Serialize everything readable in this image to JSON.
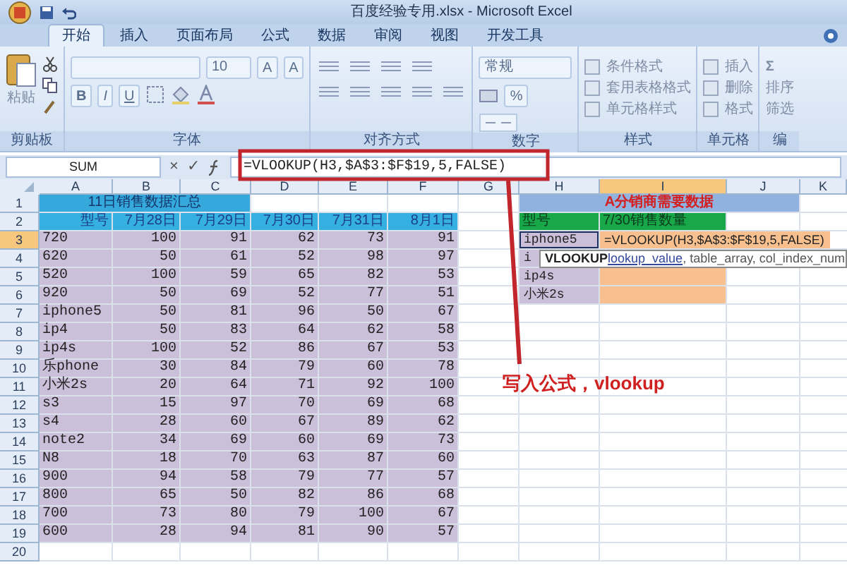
{
  "window": {
    "title": "百度经验专用.xlsx - Microsoft Excel"
  },
  "tabs": [
    {
      "label": "开始",
      "selected": true
    },
    {
      "label": "插入",
      "selected": false
    },
    {
      "label": "页面布局",
      "selected": false
    },
    {
      "label": "公式",
      "selected": false
    },
    {
      "label": "数据",
      "selected": false
    },
    {
      "label": "审阅",
      "selected": false
    },
    {
      "label": "视图",
      "selected": false
    },
    {
      "label": "开发工具",
      "selected": false
    }
  ],
  "ribbon": {
    "groups": [
      {
        "kind": "clipboard",
        "label": "剪贴板",
        "paste": "粘贴"
      },
      {
        "kind": "font",
        "label": "字体",
        "size": "10",
        "grow_shrink": [
          "A",
          "A"
        ],
        "style_buttons": [
          "B",
          "I",
          "U"
        ]
      },
      {
        "kind": "align",
        "label": "对齐方式"
      },
      {
        "kind": "number",
        "label": "数字",
        "format": "常规",
        "percent": "%"
      },
      {
        "kind": "list",
        "label": "样式",
        "items": [
          "条件格式",
          "套用表格格式",
          "单元格样式"
        ]
      },
      {
        "kind": "list",
        "label": "单元格",
        "items": [
          "插入",
          "删除",
          "格式"
        ]
      },
      {
        "kind": "editing",
        "label": "编",
        "sigma": "Σ",
        "items": [
          "排序",
          "筛选"
        ]
      }
    ]
  },
  "formula_bar": {
    "name_box": "SUM",
    "cancel": "×",
    "enter": "✓",
    "formula": "=VLOOKUP(H3,$A$3:$F$19,5,FALSE)"
  },
  "sheet": {
    "columns": [
      {
        "label": "A",
        "selected": false
      },
      {
        "label": "B",
        "selected": false
      },
      {
        "label": "C",
        "selected": false
      },
      {
        "label": "D",
        "selected": false
      },
      {
        "label": "E",
        "selected": false
      },
      {
        "label": "F",
        "selected": false
      },
      {
        "label": "G",
        "selected": false
      },
      {
        "label": "H",
        "selected": false
      },
      {
        "label": "I",
        "selected": true
      },
      {
        "label": "J",
        "selected": false
      },
      {
        "label": "K",
        "selected": false
      }
    ],
    "rows": [
      {
        "number": "1",
        "selected": false,
        "cells": [
          {
            "kind": "title",
            "text": "11日销售数据汇总"
          },
          {
            "kind": "empty"
          },
          {
            "kind": "empty"
          },
          {
            "kind": "empty"
          },
          {
            "kind": "empty"
          },
          {
            "kind": "banner",
            "text": "A分销商需要数据"
          }
        ]
      },
      {
        "number": "2",
        "selected": false,
        "cells": [
          {
            "kind": "header",
            "text": "型号"
          },
          {
            "kind": "header",
            "text": "7月28日"
          },
          {
            "kind": "header",
            "text": "7月29日"
          },
          {
            "kind": "header",
            "text": "7月30日"
          },
          {
            "kind": "header",
            "text": "7月31日"
          },
          {
            "kind": "header",
            "text": "8月1日"
          },
          {
            "kind": "empty"
          },
          {
            "kind": "key-header",
            "text": "型号"
          },
          {
            "kind": "key-header",
            "text": "7/30销售数量"
          }
        ]
      },
      {
        "number": "3",
        "selected": true,
        "cells": [
          {
            "kind": "text",
            "text": "720"
          },
          {
            "kind": "number",
            "text": "100"
          },
          {
            "kind": "number",
            "text": "91"
          },
          {
            "kind": "number",
            "text": "62"
          },
          {
            "kind": "number",
            "text": "73"
          },
          {
            "kind": "number",
            "text": "91"
          },
          {
            "kind": "empty"
          },
          {
            "kind": "key",
            "text": "iphone5"
          },
          {
            "kind": "editing",
            "text": "=VLOOKUP(H3,$A$3:$F$19,5,FALSE)"
          }
        ]
      },
      {
        "number": "4",
        "selected": false,
        "cells": [
          {
            "kind": "text",
            "text": "620"
          },
          {
            "kind": "number",
            "text": "50"
          },
          {
            "kind": "number",
            "text": "61"
          },
          {
            "kind": "number",
            "text": "52"
          },
          {
            "kind": "number",
            "text": "98"
          },
          {
            "kind": "number",
            "text": "97"
          },
          {
            "kind": "empty"
          },
          {
            "kind": "key",
            "text": "i"
          },
          {
            "kind": "lookup"
          }
        ]
      },
      {
        "number": "5",
        "selected": false,
        "cells": [
          {
            "kind": "text",
            "text": "520"
          },
          {
            "kind": "number",
            "text": "100"
          },
          {
            "kind": "number",
            "text": "59"
          },
          {
            "kind": "number",
            "text": "65"
          },
          {
            "kind": "number",
            "text": "82"
          },
          {
            "kind": "number",
            "text": "53"
          },
          {
            "kind": "empty"
          },
          {
            "kind": "key",
            "text": "ip4s"
          },
          {
            "kind": "lookup"
          }
        ]
      },
      {
        "number": "6",
        "selected": false,
        "cells": [
          {
            "kind": "text",
            "text": "920"
          },
          {
            "kind": "number",
            "text": "50"
          },
          {
            "kind": "number",
            "text": "69"
          },
          {
            "kind": "number",
            "text": "52"
          },
          {
            "kind": "number",
            "text": "77"
          },
          {
            "kind": "number",
            "text": "51"
          },
          {
            "kind": "empty"
          },
          {
            "kind": "key",
            "text": "小米2s"
          },
          {
            "kind": "lookup"
          }
        ]
      },
      {
        "number": "7",
        "selected": false,
        "cells": [
          {
            "kind": "text",
            "text": "iphone5"
          },
          {
            "kind": "number",
            "text": "50"
          },
          {
            "kind": "number",
            "text": "81"
          },
          {
            "kind": "number",
            "text": "96"
          },
          {
            "kind": "number",
            "text": "50"
          },
          {
            "kind": "number",
            "text": "67"
          }
        ]
      },
      {
        "number": "8",
        "selected": false,
        "cells": [
          {
            "kind": "text",
            "text": "ip4"
          },
          {
            "kind": "number",
            "text": "50"
          },
          {
            "kind": "number",
            "text": "83"
          },
          {
            "kind": "number",
            "text": "64"
          },
          {
            "kind": "number",
            "text": "62"
          },
          {
            "kind": "number",
            "text": "58"
          }
        ]
      },
      {
        "number": "9",
        "selected": false,
        "cells": [
          {
            "kind": "text",
            "text": "ip4s"
          },
          {
            "kind": "number",
            "text": "100"
          },
          {
            "kind": "number",
            "text": "52"
          },
          {
            "kind": "number",
            "text": "86"
          },
          {
            "kind": "number",
            "text": "67"
          },
          {
            "kind": "number",
            "text": "53"
          }
        ]
      },
      {
        "number": "10",
        "selected": false,
        "cells": [
          {
            "kind": "text",
            "text": "乐phone"
          },
          {
            "kind": "number",
            "text": "30"
          },
          {
            "kind": "number",
            "text": "84"
          },
          {
            "kind": "number",
            "text": "79"
          },
          {
            "kind": "number",
            "text": "60"
          },
          {
            "kind": "number",
            "text": "78"
          }
        ]
      },
      {
        "number": "11",
        "selected": false,
        "cells": [
          {
            "kind": "text",
            "text": "小米2s"
          },
          {
            "kind": "number",
            "text": "20"
          },
          {
            "kind": "number",
            "text": "64"
          },
          {
            "kind": "number",
            "text": "71"
          },
          {
            "kind": "number",
            "text": "92"
          },
          {
            "kind": "number",
            "text": "100"
          }
        ]
      },
      {
        "number": "12",
        "selected": false,
        "cells": [
          {
            "kind": "text",
            "text": "s3"
          },
          {
            "kind": "number",
            "text": "15"
          },
          {
            "kind": "number",
            "text": "97"
          },
          {
            "kind": "number",
            "text": "70"
          },
          {
            "kind": "number",
            "text": "69"
          },
          {
            "kind": "number",
            "text": "68"
          }
        ]
      },
      {
        "number": "13",
        "selected": false,
        "cells": [
          {
            "kind": "text",
            "text": "s4"
          },
          {
            "kind": "number",
            "text": "28"
          },
          {
            "kind": "number",
            "text": "60"
          },
          {
            "kind": "number",
            "text": "67"
          },
          {
            "kind": "number",
            "text": "89"
          },
          {
            "kind": "number",
            "text": "62"
          }
        ]
      },
      {
        "number": "14",
        "selected": false,
        "cells": [
          {
            "kind": "text",
            "text": "note2"
          },
          {
            "kind": "number",
            "text": "34"
          },
          {
            "kind": "number",
            "text": "69"
          },
          {
            "kind": "number",
            "text": "60"
          },
          {
            "kind": "number",
            "text": "69"
          },
          {
            "kind": "number",
            "text": "73"
          }
        ]
      },
      {
        "number": "15",
        "selected": false,
        "cells": [
          {
            "kind": "text",
            "text": "N8"
          },
          {
            "kind": "number",
            "text": "18"
          },
          {
            "kind": "number",
            "text": "70"
          },
          {
            "kind": "number",
            "text": "63"
          },
          {
            "kind": "number",
            "text": "87"
          },
          {
            "kind": "number",
            "text": "60"
          }
        ]
      },
      {
        "number": "16",
        "selected": false,
        "cells": [
          {
            "kind": "text",
            "text": "900"
          },
          {
            "kind": "number",
            "text": "94"
          },
          {
            "kind": "number",
            "text": "58"
          },
          {
            "kind": "number",
            "text": "79"
          },
          {
            "kind": "number",
            "text": "77"
          },
          {
            "kind": "number",
            "text": "57"
          }
        ]
      },
      {
        "number": "17",
        "selected": false,
        "cells": [
          {
            "kind": "text",
            "text": "800"
          },
          {
            "kind": "number",
            "text": "65"
          },
          {
            "kind": "number",
            "text": "50"
          },
          {
            "kind": "number",
            "text": "82"
          },
          {
            "kind": "number",
            "text": "86"
          },
          {
            "kind": "number",
            "text": "68"
          }
        ]
      },
      {
        "number": "18",
        "selected": false,
        "cells": [
          {
            "kind": "text",
            "text": "700"
          },
          {
            "kind": "number",
            "text": "73"
          },
          {
            "kind": "number",
            "text": "80"
          },
          {
            "kind": "number",
            "text": "79"
          },
          {
            "kind": "number",
            "text": "100"
          },
          {
            "kind": "number",
            "text": "67"
          }
        ]
      },
      {
        "number": "19",
        "selected": false,
        "cells": [
          {
            "kind": "text",
            "text": "600"
          },
          {
            "kind": "number",
            "text": "28"
          },
          {
            "kind": "number",
            "text": "94"
          },
          {
            "kind": "number",
            "text": "81"
          },
          {
            "kind": "number",
            "text": "90"
          },
          {
            "kind": "number",
            "text": "57"
          }
        ]
      },
      {
        "number": "20",
        "selected": false
      }
    ]
  },
  "tooltip": {
    "function": "VLOOKUP",
    "args": [
      {
        "text": "lookup_value",
        "selected": true
      },
      {
        "text": ", table_array",
        "selected": false
      },
      {
        "text": ", col_index_num",
        "selected": false
      }
    ]
  },
  "annotation": {
    "text": "写入公式，vlookup"
  }
}
